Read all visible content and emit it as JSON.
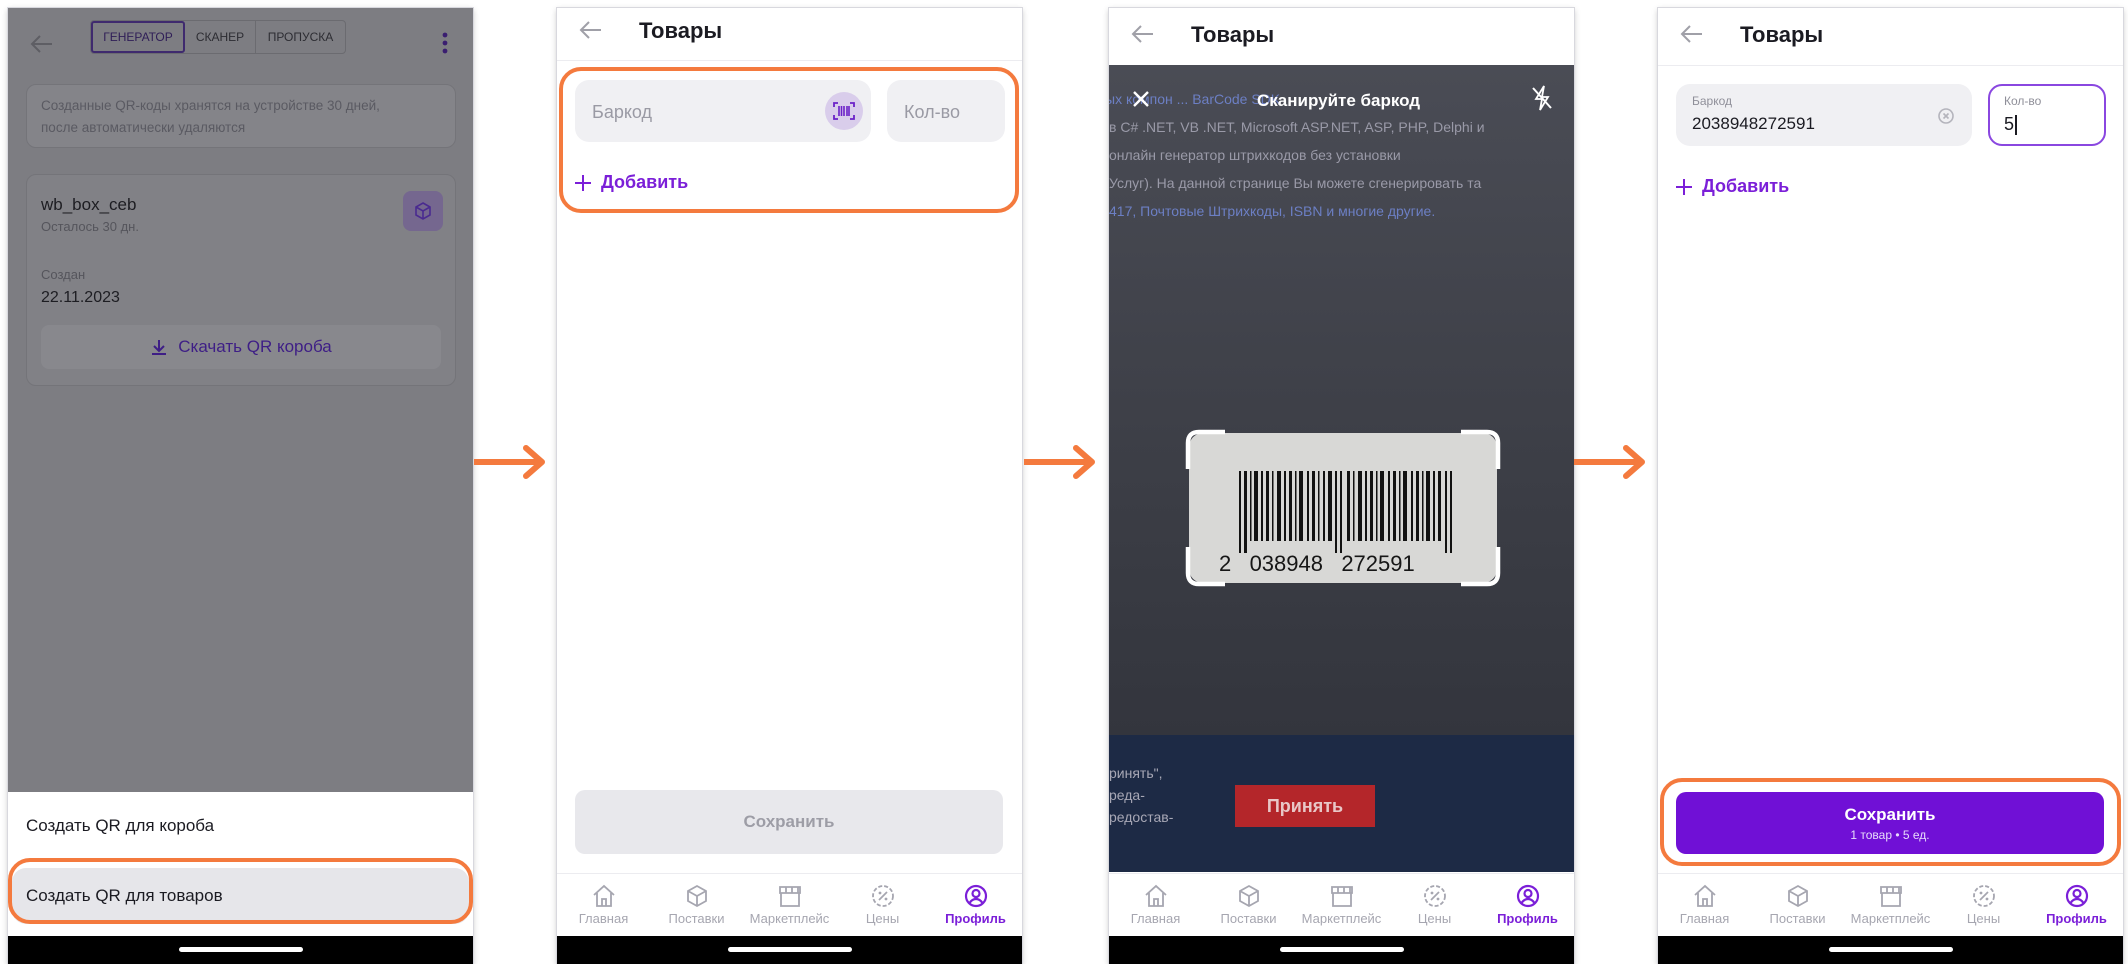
{
  "screen1": {
    "tabs": [
      "ГЕНЕРАТОР",
      "СКАНЕР",
      "ПРОПУСКА"
    ],
    "info_text_line1": "Созданные QR-коды хранятся на устройстве 30 дней,",
    "info_text_line2": "после автоматически удаляются",
    "card": {
      "name": "wb_box_ceb",
      "remaining": "Осталось 30 дн.",
      "created_label": "Создан",
      "created_date": "22.11.2023",
      "download_label": "Скачать QR короба"
    },
    "sheet": {
      "option_box": "Создать QR для короба",
      "option_goods": "Создать QR для товаров"
    }
  },
  "screen2": {
    "title": "Товары",
    "barcode_placeholder": "Баркод",
    "qty_placeholder": "Кол-во",
    "add_label": "Добавить",
    "save_label": "Сохранить"
  },
  "screen3": {
    "title": "Товары",
    "scan_label": "Сканируйте баркод",
    "camera_text": {
      "line1": "ых компон ... BarCode SDK",
      "line2": "в C# .NET, VB .NET, Microsoft ASP.NET, ASP, PHP, Delphi и",
      "line3": "онлайн генератор штрихкодов без установки",
      "line4": "Услуг). На данной странице Вы можете сгенерировать та",
      "line5": "417, Почтовые Штрихкоды, ISBN и многие другие.",
      "lower1": "ринять\",",
      "lower2": "реда-",
      "lower3": "редостав-",
      "accept_button": "Принять"
    },
    "barcode_digits": "2   038948   272591"
  },
  "screen4": {
    "title": "Товары",
    "barcode_label": "Баркод",
    "barcode_value": "2038948272591",
    "qty_label": "Кол-во",
    "qty_value": "5",
    "add_label": "Добавить",
    "save_label": "Сохранить",
    "save_sub": "1 товар • 5 ед."
  },
  "nav": {
    "home": "Главная",
    "supplies": "Поставки",
    "marketplace": "Маркетплейс",
    "prices": "Цены",
    "profile": "Профиль"
  },
  "colors": {
    "accent": "#7b1fd8",
    "highlight": "#f47a3e",
    "dim_overlay": "#7e7e84"
  }
}
